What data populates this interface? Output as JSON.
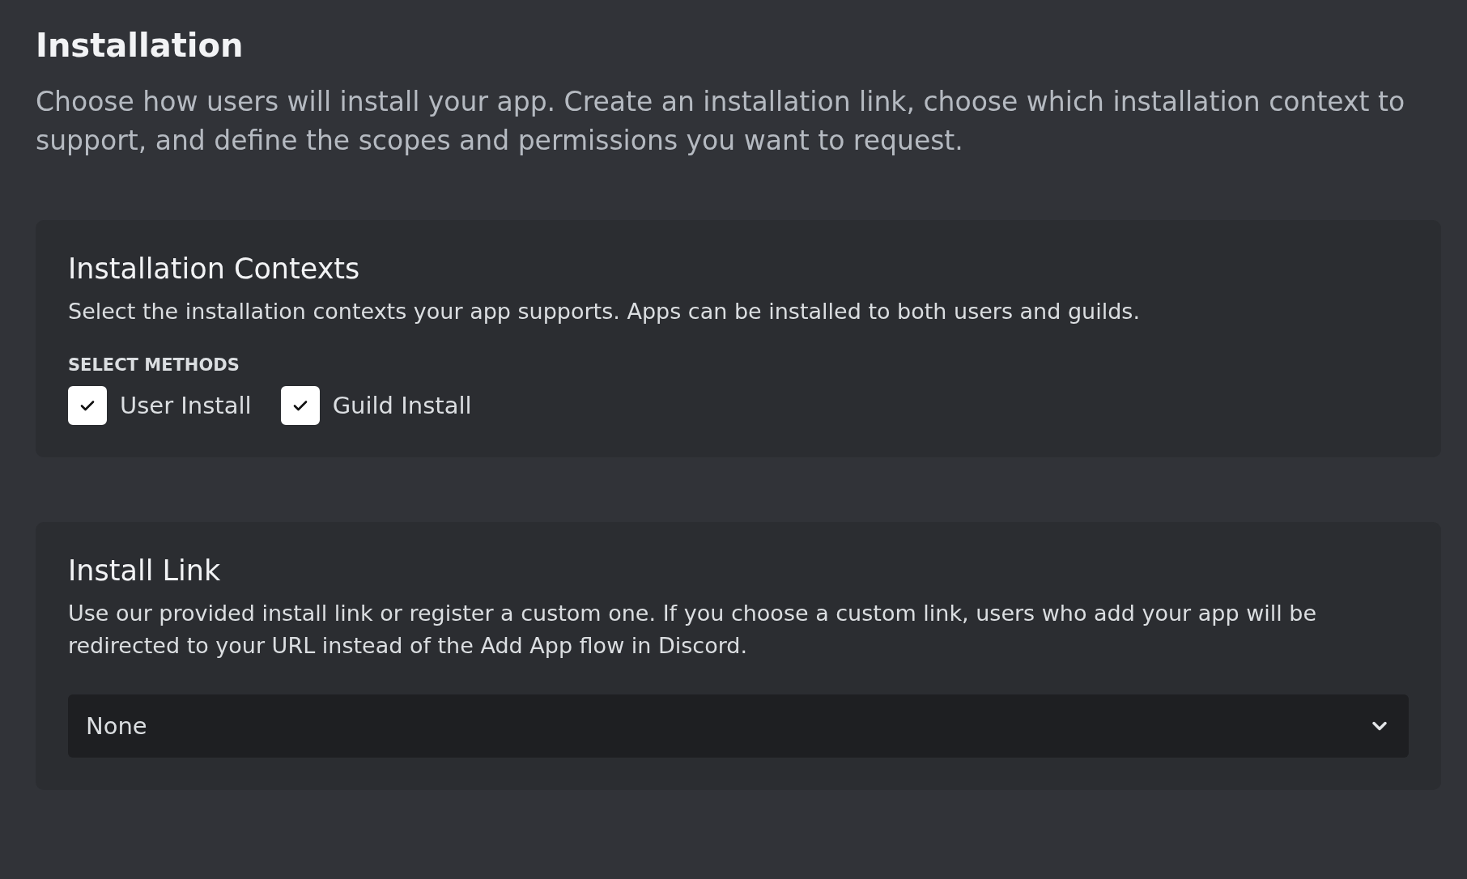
{
  "page": {
    "title": "Installation",
    "description": "Choose how users will install your app. Create an installation link, choose which installation context to support, and define the scopes and permissions you want to request."
  },
  "installation_contexts": {
    "title": "Installation Contexts",
    "description": "Select the installation contexts your app supports. Apps can be installed to both users and guilds.",
    "label": "SELECT METHODS",
    "methods": [
      {
        "label": "User Install",
        "checked": true
      },
      {
        "label": "Guild Install",
        "checked": true
      }
    ]
  },
  "install_link": {
    "title": "Install Link",
    "description": "Use our provided install link or register a custom one. If you choose a custom link, users who add your app will be redirected to your URL instead of the Add App flow in Discord.",
    "select": {
      "value": "None"
    }
  }
}
